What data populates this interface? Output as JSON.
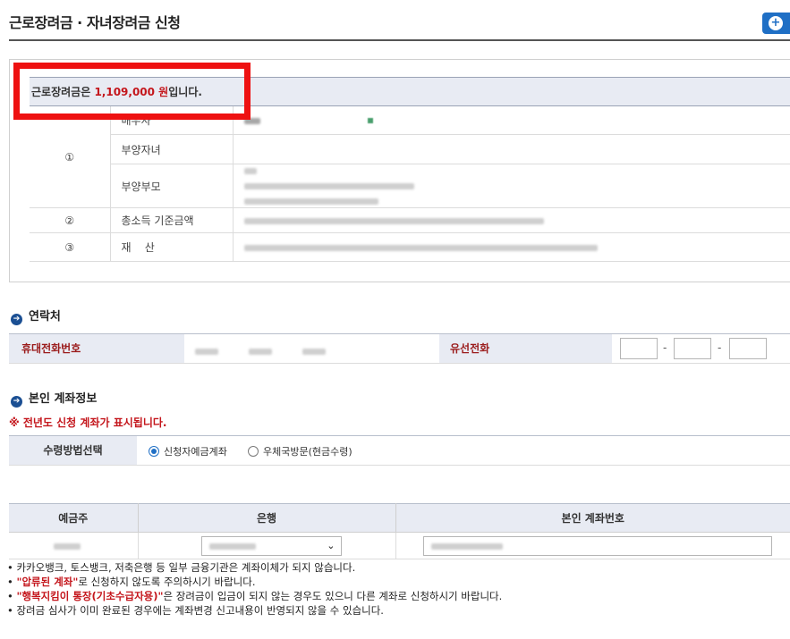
{
  "page": {
    "title": "근로장려금 · 자녀장려금 신청",
    "corner_button_icon": "circle-plus-icon",
    "accent_color": "#1f6fc5"
  },
  "summary": {
    "amount_prefix": "근로장려금은",
    "amount": "1,109,000 원",
    "amount_suffix": "입니다.",
    "rows": [
      {
        "num": "①",
        "label": "배우자"
      },
      {
        "num": "",
        "label": "부양자녀"
      },
      {
        "num": "",
        "label": "부양부모"
      },
      {
        "num": "②",
        "label": "총소득 기준금액"
      },
      {
        "num": "③",
        "label": "재    산"
      }
    ]
  },
  "contact": {
    "section_title": "연락처",
    "mobile_label": "휴대전화번호",
    "landline_label": "유선전화",
    "dash": "-"
  },
  "account": {
    "section_title": "본인 계좌정보",
    "notice": "※ 전년도 신청 계좌가 표시됩니다.",
    "method_label": "수령방법선택",
    "option_bank": "신청자예금계좌",
    "option_post": "우체국방문(현금수령)",
    "selected_option": "신청자예금계좌",
    "headers": [
      "예금주",
      "은행",
      "본인 계좌번호"
    ]
  },
  "notes": {
    "line1": "카카오뱅크, 토스뱅크, 저축은행 등 일부 금융기관은 계좌이체가 되지 않습니다.",
    "line2_red": "\"압류된 계좌\"",
    "line2_rest": "로 신청하지 않도록 주의하시기 바랍니다.",
    "line3_red": "\"행복지킴이 통장(기초수급자용)\"",
    "line3_rest": "은 장려금이 입금이 되지 않는 경우도 있으니 다른 계좌로 신청하시기 바랍니다.",
    "line4": "장려금 심사가 이미 완료된 경우에는 계좌변경 신고내용이 반영되지 않을 수 있습니다."
  }
}
